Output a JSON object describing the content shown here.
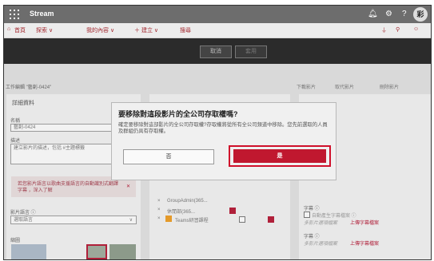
{
  "suite": {
    "brand": "Stream",
    "avatar": "彩",
    "icons": [
      "waffle-icon",
      "bell-icon",
      "gear-icon",
      "help-icon"
    ]
  },
  "nav": {
    "items": [
      "首頁",
      "探索 ∨",
      "我的內容 ∨",
      "＋ 建立 ∨",
      "搜尋"
    ]
  },
  "command": {
    "cancel": "取消",
    "apply": "套用"
  },
  "page": {
    "path": "工作編輯 \"藝創-0424\"",
    "tools": [
      "下載影片",
      "取代影片",
      "刪除影片"
    ],
    "details": {
      "header": "詳細資料",
      "name_label": "名稱",
      "name_value": "藝創-0424",
      "desc_label": "描述",
      "desc_placeholder": "建立影片的描述，包括 #主題標籤",
      "note_text": "若您影片語言以歌曲支援語言的自動識別式翻譯字幕 ，深入了解",
      "lang_label": "影片語言 ⓘ",
      "lang_value": "選取語言",
      "thumb_label": "縮圖"
    },
    "permissions": {
      "rows": [
        {
          "name": "GroupAdmin(365...",
          "c1": false,
          "c2": false
        },
        {
          "name": "休閒部(365...",
          "c1": true,
          "c2": false
        },
        {
          "name": "Teams研習課程",
          "c1": false,
          "c2": true
        }
      ]
    },
    "options": {
      "sub1_label": "字幕 ⓘ",
      "sub1_check": "自動產生字幕檔案 ⓘ",
      "sub1_link1": "多影片選項檔案",
      "sub1_link2": "上傳字幕檔案",
      "sub2_label": "字幕 ⓘ",
      "sub2_link1": "多影片選項檔案",
      "sub2_link2": "上傳字幕檔案"
    }
  },
  "dialog": {
    "title": "要移除對這段影片的全公司存取權嗎?",
    "description": "確定要移除對這部影片的全公司存取權?存取權將從所有全公司頻道中移除。您先前選取的人員及群組仍具有存取權。",
    "no_label": "否",
    "yes_label": "是"
  },
  "colors": {
    "accent": "#c0182f",
    "suite_bar": "#6d6d6d",
    "command_bar": "#2b2b2b"
  }
}
